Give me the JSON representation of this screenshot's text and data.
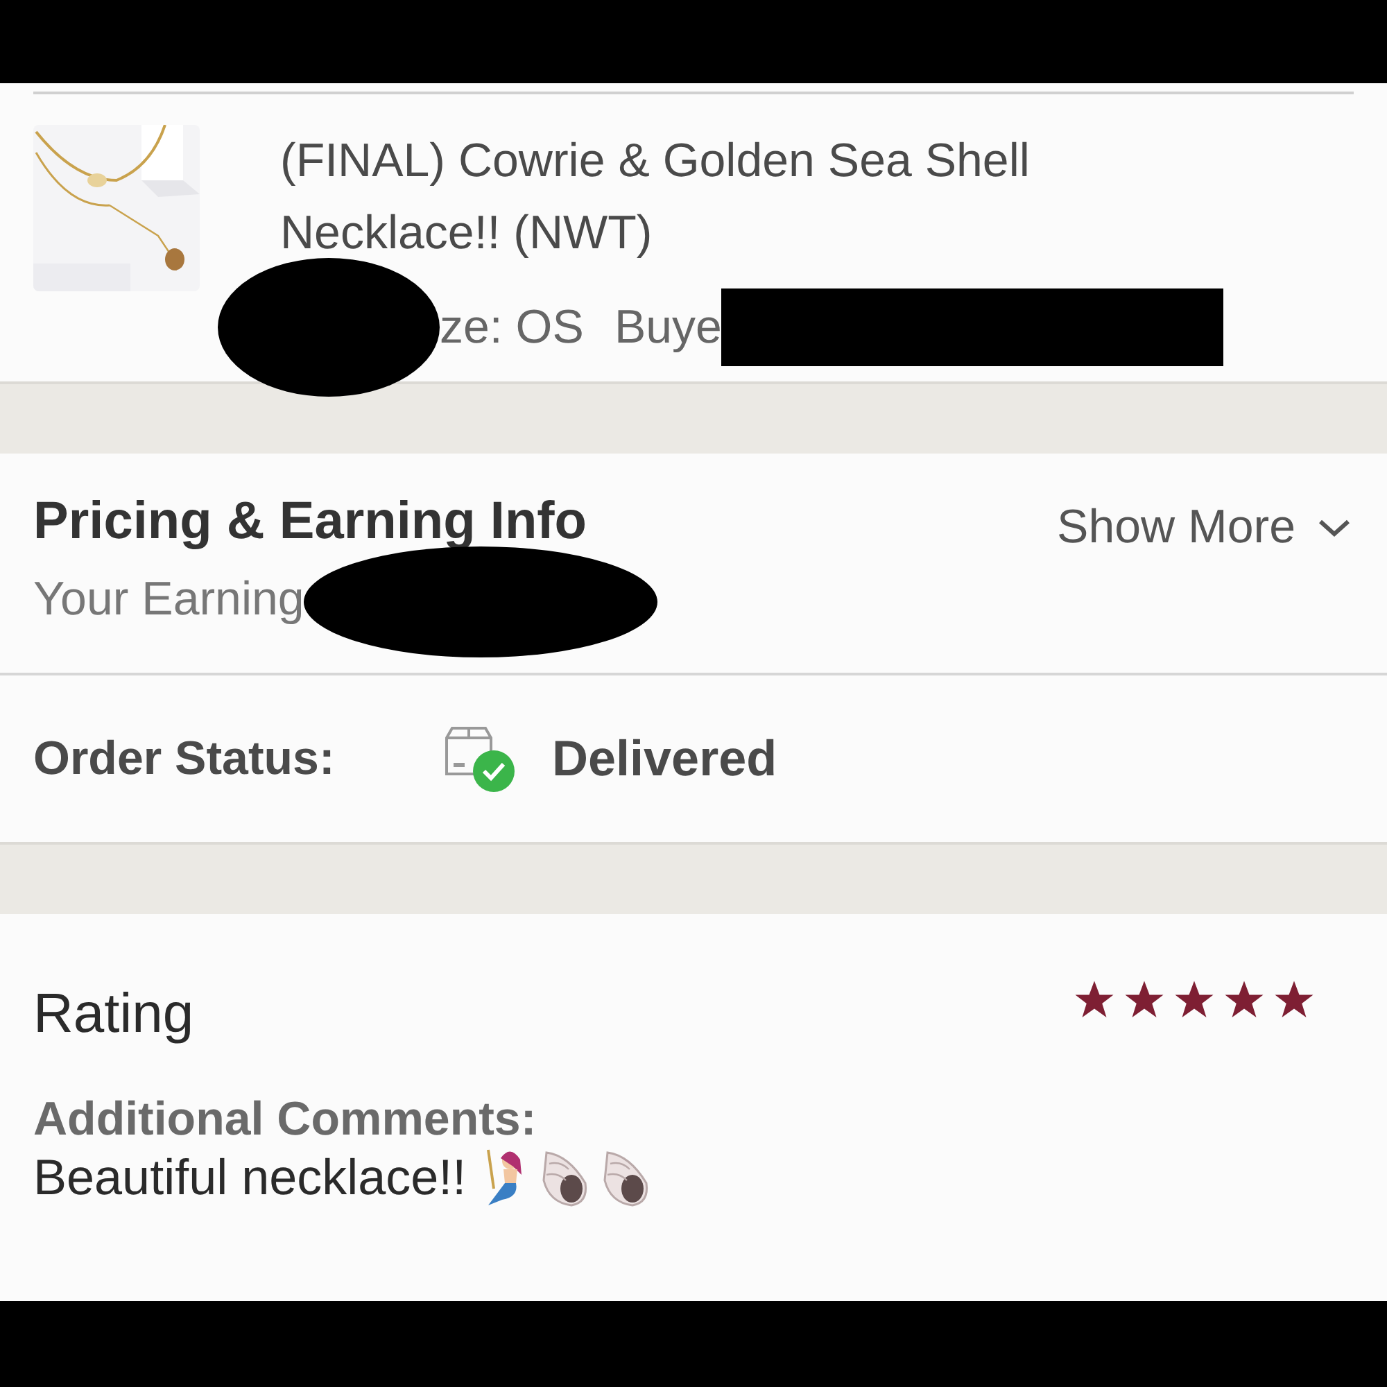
{
  "item": {
    "title": "(FINAL) Cowrie & Golden Sea Shell Necklace!! (NWT)",
    "size": "ze: OS",
    "buyer": "Buye"
  },
  "pricing": {
    "title": "Pricing & Earning Info",
    "earnings_label": "Your Earning",
    "show_more": "Show More"
  },
  "order_status": {
    "label": "Order Status:",
    "value": "Delivered"
  },
  "rating": {
    "title": "Rating",
    "stars": 5,
    "comments_label": "Additional Comments:",
    "comment": "Beautiful necklace!!"
  }
}
